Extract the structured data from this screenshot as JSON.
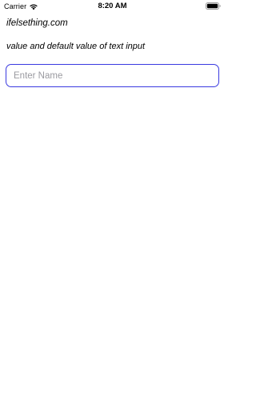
{
  "status_bar": {
    "carrier": "Carrier",
    "time": "8:20 AM",
    "wifi_icon": "wifi-icon",
    "battery_icon": "battery-icon"
  },
  "page": {
    "site_title": "ifelsething.com",
    "subtitle": "value and default value of text input"
  },
  "name_input": {
    "value": "",
    "placeholder": "Enter Name",
    "border_color": "#3a3ae0"
  }
}
